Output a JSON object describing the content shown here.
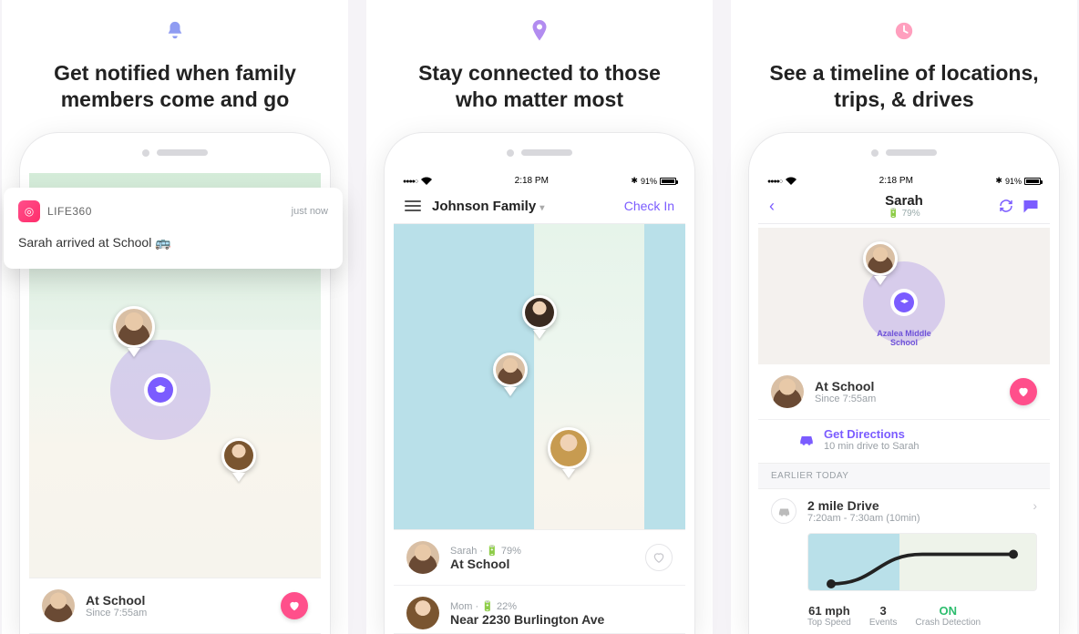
{
  "panels": [
    {
      "icon": "bell",
      "color": "#8f9cf2",
      "title_l1": "Get notified when family",
      "title_l2": "members come and go"
    },
    {
      "icon": "pin",
      "color": "#b28cf0",
      "title_l1": "Stay connected to those",
      "title_l2": "who matter most"
    },
    {
      "icon": "clock",
      "color": "#ff9fbe",
      "title_l1": "See a timeline of locations,",
      "title_l2": "trips, & drives"
    }
  ],
  "notification": {
    "app": "LIFE360",
    "when": "just now",
    "body": "Sarah arrived at School 🚌"
  },
  "panel1": {
    "card": {
      "title": "At School",
      "sub": "Since 7:55am"
    }
  },
  "status": {
    "time": "2:18 PM",
    "battery": "91%"
  },
  "panel2": {
    "family": "Johnson Family",
    "checkin": "Check In",
    "list": [
      {
        "name": "Sarah",
        "battery": "79%",
        "title": "At School"
      },
      {
        "name": "Mom",
        "battery": "22%",
        "title": "Near 2230 Burlington Ave"
      }
    ]
  },
  "panel3": {
    "name": "Sarah",
    "battery": "79%",
    "place": "Azalea Middle School",
    "card": {
      "title": "At School",
      "sub": "Since 7:55am"
    },
    "directions": {
      "title": "Get Directions",
      "sub": "10 min drive to Sarah"
    },
    "section": "EARLIER TODAY",
    "drive": {
      "title": "2 mile Drive",
      "sub": "7:20am - 7:30am (10min)"
    },
    "stats": {
      "speed": {
        "value": "61 mph",
        "label": "Top Speed"
      },
      "events": {
        "value": "3",
        "label": "Events"
      },
      "crash": {
        "value": "ON",
        "label": "Crash Detection"
      }
    }
  }
}
